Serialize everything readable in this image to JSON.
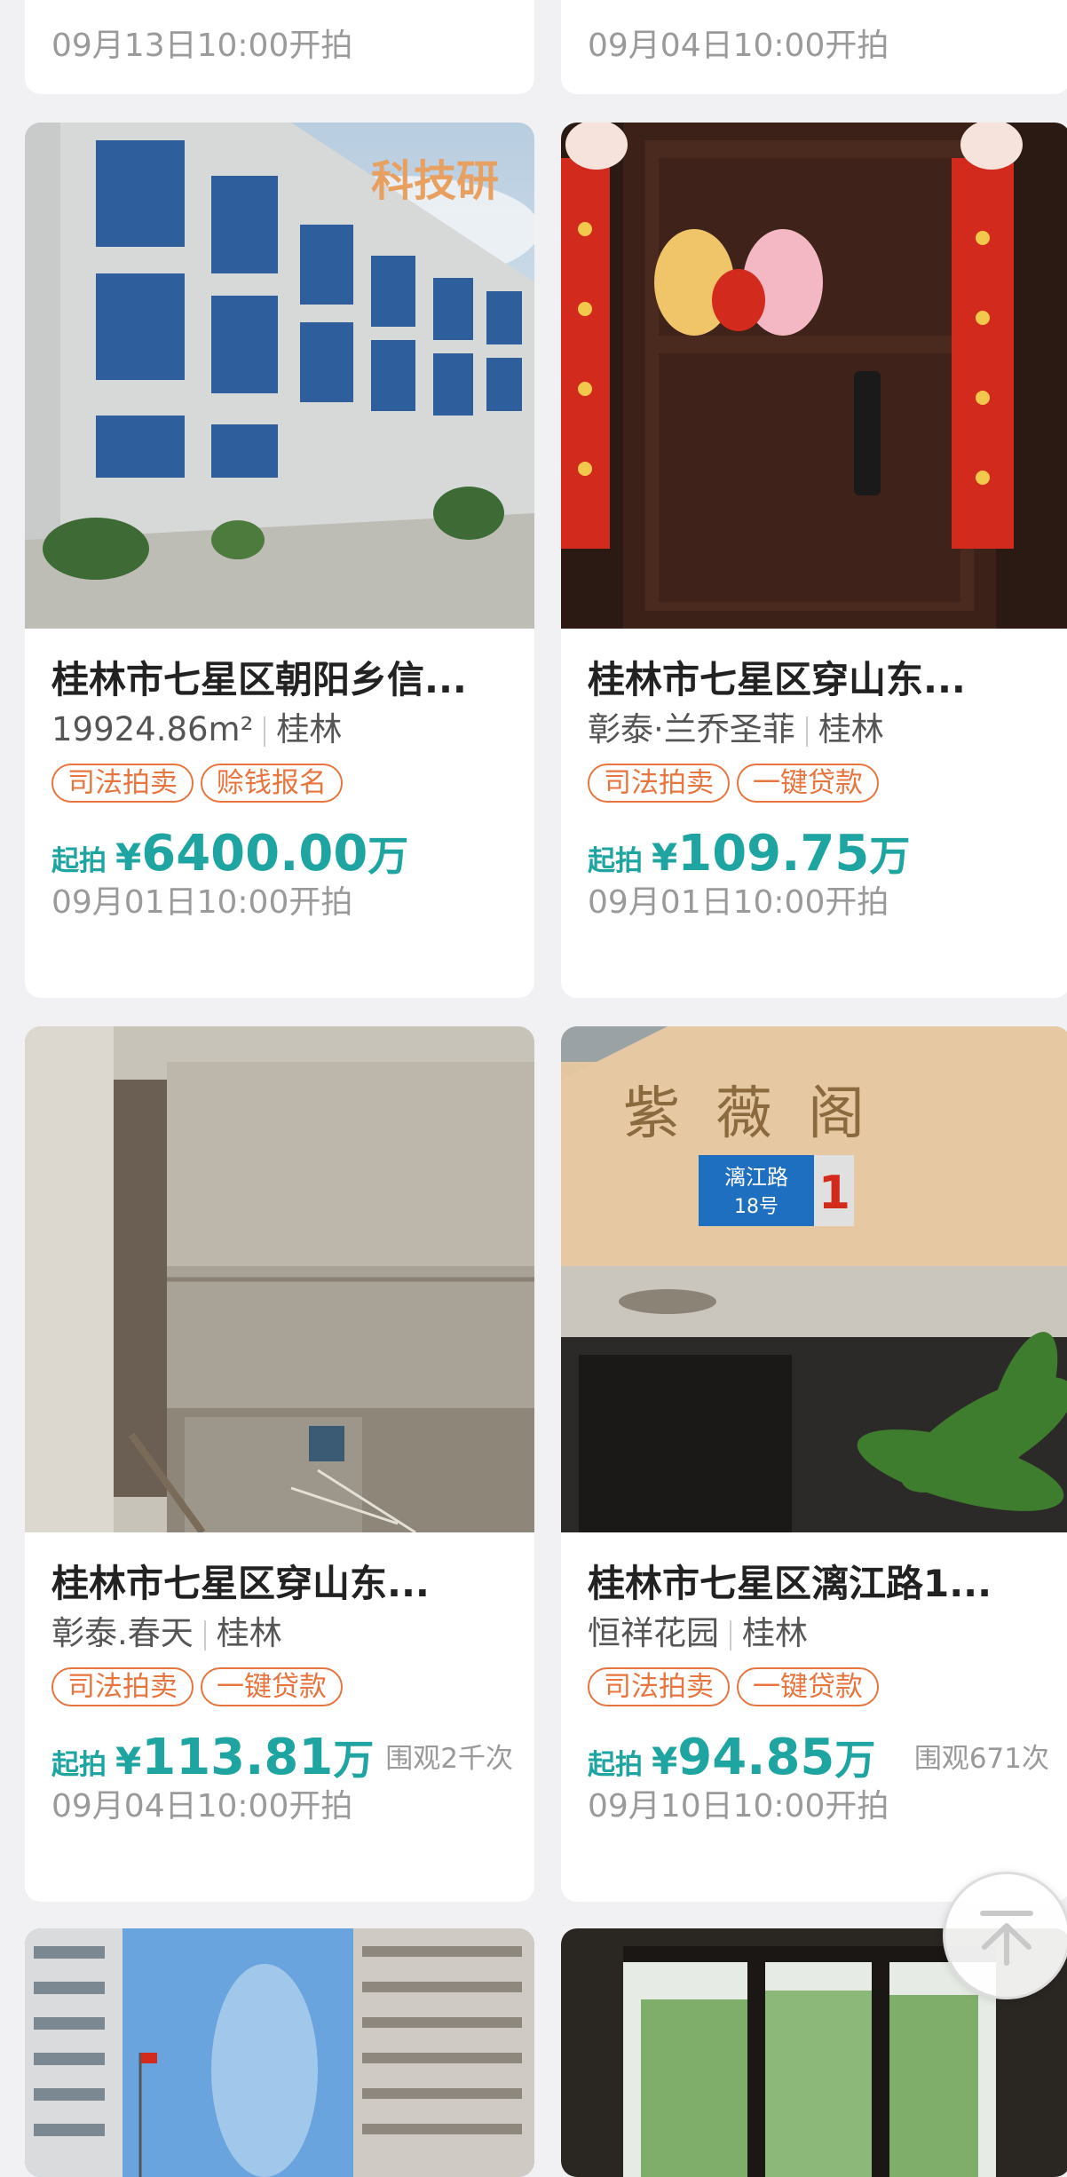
{
  "top_cards": [
    {
      "date": "09月13日10:00开拍"
    },
    {
      "date": "09月04日10:00开拍"
    }
  ],
  "listings": [
    {
      "title": "桂林市七星区朝阳乡信...",
      "subtitle_a": "19924.86m²",
      "subtitle_b": "桂林",
      "tags": [
        "司法拍卖",
        "赊钱报名"
      ],
      "price_label": "起拍",
      "currency": "¥",
      "amount": "6400.00",
      "unit": "万",
      "views": "",
      "date": "09月01日10:00开拍",
      "photo_text": "科技研"
    },
    {
      "title": "桂林市七星区穿山东...",
      "subtitle_a": "彰泰·兰乔圣菲",
      "subtitle_b": "桂林",
      "tags": [
        "司法拍卖",
        "一键贷款"
      ],
      "price_label": "起拍",
      "currency": "¥",
      "amount": "109.75",
      "unit": "万",
      "views": "",
      "date": "09月01日10:00开拍"
    },
    {
      "title": "桂林市七星区穿山东...",
      "subtitle_a": "彰泰.春天",
      "subtitle_b": "桂林",
      "tags": [
        "司法拍卖",
        "一键贷款"
      ],
      "price_label": "起拍",
      "currency": "¥",
      "amount": "113.81",
      "unit": "万",
      "views": "围观2千次",
      "date": "09月04日10:00开拍"
    },
    {
      "title": "桂林市七星区漓江路1...",
      "subtitle_a": "恒祥花园",
      "subtitle_b": "桂林",
      "tags": [
        "司法拍卖",
        "一键贷款"
      ],
      "price_label": "起拍",
      "currency": "¥",
      "amount": "94.85",
      "unit": "万",
      "views": "围观671次",
      "date": "09月10日10:00开拍",
      "photo_text": "紫薇阁",
      "sign_text": "漓江路",
      "sign_num": "18号",
      "sign_badge": "1"
    }
  ],
  "colors": {
    "accent": "#1fa5a1",
    "tag": "#e8743e",
    "background": "#f1f1f3"
  },
  "back_to_top_icon": "arrow-up-icon"
}
